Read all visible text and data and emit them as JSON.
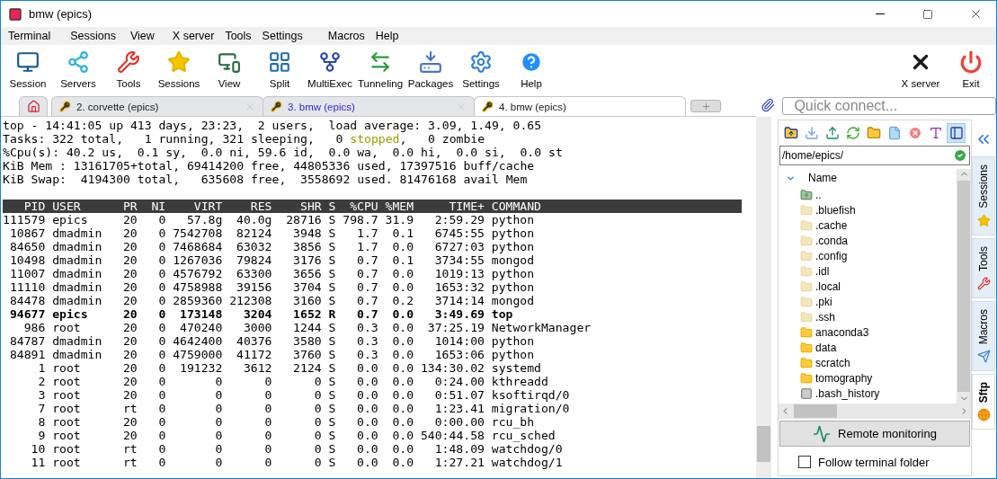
{
  "window": {
    "title": "bmw (epics)"
  },
  "menu": [
    "Terminal",
    "Sessions",
    "View",
    "X server",
    "Tools",
    "Settings",
    "Macros",
    "Help"
  ],
  "toolbar": {
    "left": [
      {
        "kind": "session",
        "label": "Session"
      },
      {
        "kind": "servers",
        "label": "Servers"
      },
      {
        "kind": "tools",
        "label": "Tools"
      },
      {
        "kind": "sessions",
        "label": "Sessions"
      },
      {
        "kind": "view",
        "label": "View"
      },
      {
        "kind": "split",
        "label": "Split"
      },
      {
        "kind": "multiexec",
        "label": "MultiExec"
      },
      {
        "kind": "tunneling",
        "label": "Tunneling"
      },
      {
        "kind": "packages",
        "label": "Packages"
      },
      {
        "kind": "settings",
        "label": "Settings"
      },
      {
        "kind": "help",
        "label": "Help"
      }
    ],
    "right": [
      {
        "kind": "xserver",
        "label": "X server"
      },
      {
        "kind": "exit",
        "label": "Exit"
      }
    ]
  },
  "tabs": [
    {
      "label": "2. corvette (epics)",
      "selected": false,
      "highlighted": false,
      "closable": true
    },
    {
      "label": "3. bmw (epics)",
      "selected": false,
      "highlighted": true,
      "closable": true
    },
    {
      "label": "4. bmw (epics)",
      "selected": true,
      "highlighted": false,
      "closable": false
    }
  ],
  "quick_connect": {
    "placeholder": "Quick connect..."
  },
  "terminal": {
    "summary": [
      {
        "segments": [
          {
            "text": "top - 14:41:05 up 413 days, 23:23,  2 users,  load average: 3.09, 1.49, 0.65",
            "highlight": false
          }
        ]
      },
      {
        "segments": [
          {
            "text": "Tasks: 322 total,   1 running, 321 sleeping,   0 ",
            "highlight": false
          },
          {
            "text": "stopped",
            "highlight": true
          },
          {
            "text": ",   0 zombie",
            "highlight": false
          }
        ]
      },
      {
        "segments": [
          {
            "text": "%Cpu(s): 40.2 us,  0.1 sy,  0.0 ni, 59.6 id,  0.0 wa,  0.0 hi,  0.0 si,  0.0 st",
            "highlight": false
          }
        ]
      },
      {
        "segments": [
          {
            "text": "KiB Mem : 13161705+total, 69414200 free, 44805336 used, 17397516 buff/cache",
            "highlight": false
          }
        ]
      },
      {
        "segments": [
          {
            "text": "KiB Swap:  4194300 total,   635608 free,  3558692 used. 81476168 avail Mem",
            "highlight": false
          }
        ]
      }
    ],
    "columns": [
      "PID",
      "USER",
      "PR",
      "NI",
      "VIRT",
      "RES",
      "SHR",
      "S",
      "%CPU",
      "%MEM",
      "TIME+",
      "COMMAND"
    ],
    "rows": [
      {
        "bold": false,
        "cells": [
          "111579",
          "epics",
          "20",
          "0",
          "57.8g",
          "40.0g",
          "28716",
          "S",
          "798.7",
          "31.9",
          "2:59.29",
          "python"
        ]
      },
      {
        "bold": false,
        "cells": [
          "10867",
          "dmadmin",
          "20",
          "0",
          "7542708",
          "82124",
          "3948",
          "S",
          "1.7",
          "0.1",
          "6745:55",
          "python"
        ]
      },
      {
        "bold": false,
        "cells": [
          "84650",
          "dmadmin",
          "20",
          "0",
          "7468684",
          "63032",
          "3856",
          "S",
          "1.7",
          "0.0",
          "6727:03",
          "python"
        ]
      },
      {
        "bold": false,
        "cells": [
          "10498",
          "dmadmin",
          "20",
          "0",
          "1267036",
          "79824",
          "3176",
          "S",
          "0.7",
          "0.1",
          "3734:55",
          "mongod"
        ]
      },
      {
        "bold": false,
        "cells": [
          "11007",
          "dmadmin",
          "20",
          "0",
          "4576792",
          "63300",
          "3656",
          "S",
          "0.7",
          "0.0",
          "1019:13",
          "python"
        ]
      },
      {
        "bold": false,
        "cells": [
          "11110",
          "dmadmin",
          "20",
          "0",
          "4758988",
          "39156",
          "3704",
          "S",
          "0.7",
          "0.0",
          "1653:32",
          "python"
        ]
      },
      {
        "bold": false,
        "cells": [
          "84478",
          "dmadmin",
          "20",
          "0",
          "2859360",
          "212308",
          "3160",
          "S",
          "0.7",
          "0.2",
          "3714:14",
          "mongod"
        ]
      },
      {
        "bold": true,
        "cells": [
          "94677",
          "epics",
          "20",
          "0",
          "173148",
          "3204",
          "1652",
          "R",
          "0.7",
          "0.0",
          "3:49.69",
          "top"
        ]
      },
      {
        "bold": false,
        "cells": [
          "986",
          "root",
          "20",
          "0",
          "470240",
          "3000",
          "1244",
          "S",
          "0.3",
          "0.0",
          "37:25.19",
          "NetworkManager"
        ]
      },
      {
        "bold": false,
        "cells": [
          "84787",
          "dmadmin",
          "20",
          "0",
          "4642400",
          "40376",
          "3580",
          "S",
          "0.3",
          "0.0",
          "1014:00",
          "python"
        ]
      },
      {
        "bold": false,
        "cells": [
          "84891",
          "dmadmin",
          "20",
          "0",
          "4759000",
          "41172",
          "3760",
          "S",
          "0.3",
          "0.0",
          "1653:06",
          "python"
        ]
      },
      {
        "bold": false,
        "cells": [
          "1",
          "root",
          "20",
          "0",
          "191232",
          "3612",
          "2124",
          "S",
          "0.0",
          "0.0",
          "134:30.02",
          "systemd"
        ]
      },
      {
        "bold": false,
        "cells": [
          "2",
          "root",
          "20",
          "0",
          "0",
          "0",
          "0",
          "S",
          "0.0",
          "0.0",
          "0:24.00",
          "kthreadd"
        ]
      },
      {
        "bold": false,
        "cells": [
          "3",
          "root",
          "20",
          "0",
          "0",
          "0",
          "0",
          "S",
          "0.0",
          "0.0",
          "0:51.07",
          "ksoftirqd/0"
        ]
      },
      {
        "bold": false,
        "cells": [
          "7",
          "root",
          "rt",
          "0",
          "0",
          "0",
          "0",
          "S",
          "0.0",
          "0.0",
          "1:23.41",
          "migration/0"
        ]
      },
      {
        "bold": false,
        "cells": [
          "8",
          "root",
          "20",
          "0",
          "0",
          "0",
          "0",
          "S",
          "0.0",
          "0.0",
          "0:00.00",
          "rcu_bh"
        ]
      },
      {
        "bold": false,
        "cells": [
          "9",
          "root",
          "20",
          "0",
          "0",
          "0",
          "0",
          "S",
          "0.0",
          "0.0",
          "540:44.58",
          "rcu_sched"
        ]
      },
      {
        "bold": false,
        "cells": [
          "10",
          "root",
          "rt",
          "0",
          "0",
          "0",
          "0",
          "S",
          "0.0",
          "0.0",
          "1:48.09",
          "watchdog/0"
        ]
      },
      {
        "bold": false,
        "cells": [
          "11",
          "root",
          "rt",
          "0",
          "0",
          "0",
          "0",
          "S",
          "0.0",
          "0.0",
          "1:27.21",
          "watchdog/1"
        ]
      }
    ]
  },
  "sftp": {
    "panel_toggle_on": true,
    "path": "/home/epics/",
    "name_column": "Name",
    "items": [
      {
        "kind": "parent",
        "name": ".."
      },
      {
        "kind": "folder",
        "name": ".bluefish",
        "hidden": true
      },
      {
        "kind": "folder",
        "name": ".cache",
        "hidden": true
      },
      {
        "kind": "folder",
        "name": ".conda",
        "hidden": true
      },
      {
        "kind": "folder",
        "name": ".config",
        "hidden": true
      },
      {
        "kind": "folder",
        "name": ".idl",
        "hidden": true
      },
      {
        "kind": "folder",
        "name": ".local",
        "hidden": true
      },
      {
        "kind": "folder",
        "name": ".pki",
        "hidden": true
      },
      {
        "kind": "folder",
        "name": ".ssh",
        "hidden": true
      },
      {
        "kind": "folder",
        "name": "anaconda3",
        "hidden": false
      },
      {
        "kind": "folder",
        "name": "data",
        "hidden": false
      },
      {
        "kind": "folder",
        "name": "scratch",
        "hidden": false
      },
      {
        "kind": "folder",
        "name": "tomography",
        "hidden": false
      },
      {
        "kind": "file",
        "name": ".bash_history"
      }
    ],
    "monitor_button": "Remote monitoring",
    "follow": {
      "label": "Follow terminal folder",
      "checked": false
    }
  },
  "side_tabs": [
    {
      "kind": "sessions",
      "label": "Sessions",
      "selected": false
    },
    {
      "kind": "tools",
      "label": "Tools",
      "selected": false
    },
    {
      "kind": "macros",
      "label": "Macros",
      "selected": false
    },
    {
      "kind": "sftp",
      "label": "Sftp",
      "selected": true
    }
  ]
}
